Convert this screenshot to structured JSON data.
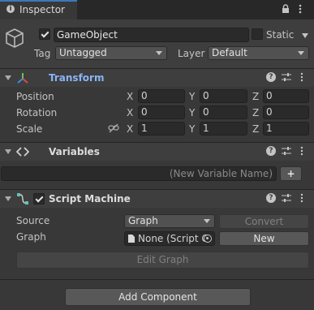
{
  "tab": {
    "label": "Inspector"
  },
  "gameobject": {
    "name": "GameObject",
    "static_label": "Static",
    "tag_label": "Tag",
    "tag_value": "Untagged",
    "layer_label": "Layer",
    "layer_value": "Default"
  },
  "transform": {
    "title": "Transform",
    "position_label": "Position",
    "rotation_label": "Rotation",
    "scale_label": "Scale",
    "axes": [
      "X",
      "Y",
      "Z"
    ],
    "position": [
      "0",
      "0",
      "0"
    ],
    "rotation": [
      "0",
      "0",
      "0"
    ],
    "scale": [
      "1",
      "1",
      "1"
    ]
  },
  "variables": {
    "title": "Variables",
    "new_placeholder": "(New Variable Name)",
    "add_label": "+"
  },
  "script_machine": {
    "title": "Script Machine",
    "source_label": "Source",
    "source_value": "Graph",
    "convert_label": "Convert",
    "graph_label": "Graph",
    "graph_value": "None (Script G",
    "new_label": "New",
    "edit_graph_label": "Edit Graph"
  },
  "footer": {
    "add_component_label": "Add Component"
  },
  "colors": {
    "transform_title": "#8ab4f7",
    "background": "#383838"
  }
}
